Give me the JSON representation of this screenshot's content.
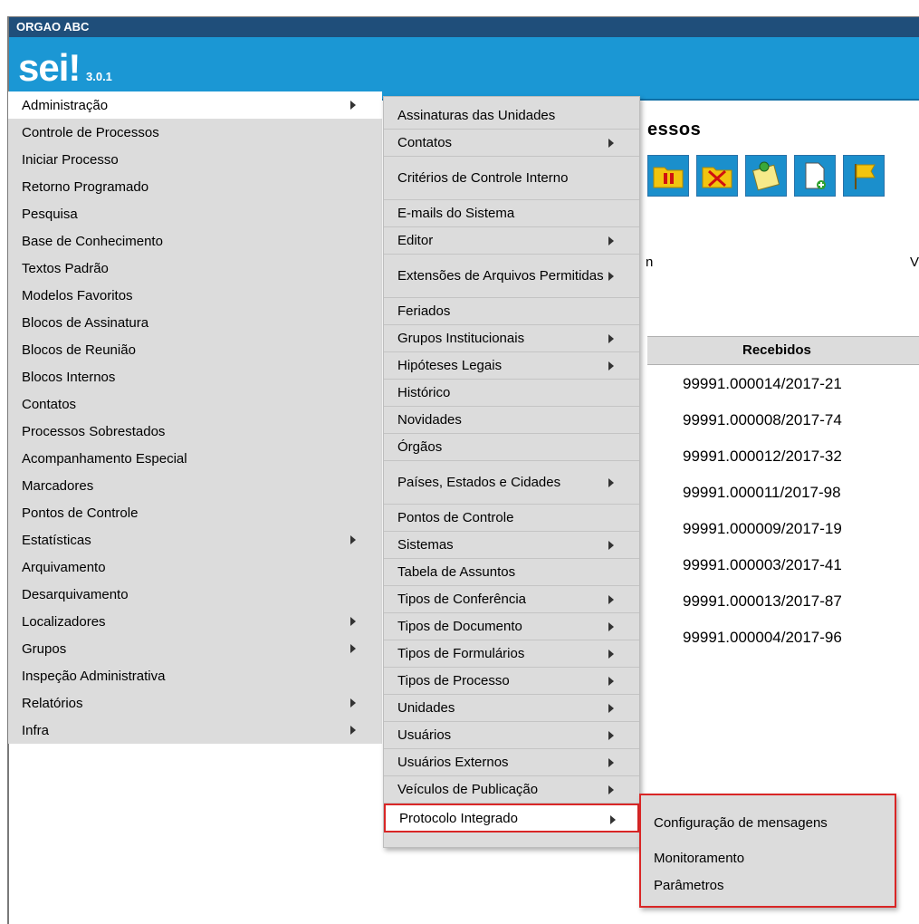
{
  "header": {
    "org_name": "ORGAO ABC",
    "logo_text": "sei",
    "logo_excl": "!",
    "version": "3.0.1"
  },
  "background": {
    "title_fragment": "essos",
    "text_fragment_1": "n",
    "text_fragment_2": "V",
    "table_header": "Recebidos",
    "processes": [
      "99991.000014/2017-21",
      "99991.000008/2017-74",
      "99991.000012/2017-32",
      "99991.000011/2017-98",
      "99991.000009/2017-19",
      "99991.000003/2017-41",
      "99991.000013/2017-87",
      "99991.000004/2017-96"
    ],
    "toolbar_icons": [
      "folder-pause-icon",
      "remove-folder-icon",
      "attach-note-icon",
      "new-document-icon",
      "flag-icon"
    ]
  },
  "main_menu": [
    {
      "label": "Administração",
      "submenu": true,
      "active": true
    },
    {
      "label": "Controle de Processos",
      "submenu": false
    },
    {
      "label": "Iniciar Processo",
      "submenu": false
    },
    {
      "label": "Retorno Programado",
      "submenu": false
    },
    {
      "label": "Pesquisa",
      "submenu": false
    },
    {
      "label": "Base de Conhecimento",
      "submenu": false
    },
    {
      "label": "Textos Padrão",
      "submenu": false
    },
    {
      "label": "Modelos Favoritos",
      "submenu": false
    },
    {
      "label": "Blocos de Assinatura",
      "submenu": false
    },
    {
      "label": "Blocos de Reunião",
      "submenu": false
    },
    {
      "label": "Blocos Internos",
      "submenu": false
    },
    {
      "label": "Contatos",
      "submenu": false
    },
    {
      "label": "Processos Sobrestados",
      "submenu": false
    },
    {
      "label": "Acompanhamento Especial",
      "submenu": false
    },
    {
      "label": "Marcadores",
      "submenu": false
    },
    {
      "label": "Pontos de Controle",
      "submenu": false
    },
    {
      "label": "Estatísticas",
      "submenu": true
    },
    {
      "label": "Arquivamento",
      "submenu": false
    },
    {
      "label": "Desarquivamento",
      "submenu": false
    },
    {
      "label": "Localizadores",
      "submenu": true
    },
    {
      "label": "Grupos",
      "submenu": true
    },
    {
      "label": "Inspeção Administrativa",
      "submenu": false
    },
    {
      "label": "Relatórios",
      "submenu": true
    },
    {
      "label": "Infra",
      "submenu": true
    }
  ],
  "admin_submenu": [
    {
      "label": "Assinaturas das Unidades",
      "submenu": false
    },
    {
      "label": "Contatos",
      "submenu": true
    },
    {
      "label": "Critérios de Controle Interno",
      "submenu": false
    },
    {
      "label": "E-mails do Sistema",
      "submenu": false
    },
    {
      "label": "Editor",
      "submenu": true
    },
    {
      "label": "Extensões de Arquivos Permitidas",
      "submenu": true
    },
    {
      "label": "Feriados",
      "submenu": false
    },
    {
      "label": "Grupos Institucionais",
      "submenu": true
    },
    {
      "label": "Hipóteses Legais",
      "submenu": true
    },
    {
      "label": "Histórico",
      "submenu": false
    },
    {
      "label": "Novidades",
      "submenu": false
    },
    {
      "label": "Órgãos",
      "submenu": false
    },
    {
      "label": "Países, Estados e Cidades",
      "submenu": true
    },
    {
      "label": "Pontos de Controle",
      "submenu": false
    },
    {
      "label": "Sistemas",
      "submenu": true
    },
    {
      "label": "Tabela de Assuntos",
      "submenu": false
    },
    {
      "label": "Tipos de Conferência",
      "submenu": true
    },
    {
      "label": "Tipos de Documento",
      "submenu": true
    },
    {
      "label": "Tipos de Formulários",
      "submenu": true
    },
    {
      "label": "Tipos de Processo",
      "submenu": true
    },
    {
      "label": "Unidades",
      "submenu": true
    },
    {
      "label": "Usuários",
      "submenu": true
    },
    {
      "label": "Usuários Externos",
      "submenu": true
    },
    {
      "label": "Veículos de Publicação",
      "submenu": true
    },
    {
      "label": "Protocolo Integrado",
      "submenu": true,
      "highlight": true
    }
  ],
  "protocolo_submenu": [
    {
      "label": "Configuração de mensagens"
    },
    {
      "label": "Monitoramento"
    },
    {
      "label": "Parâmetros"
    }
  ],
  "colors": {
    "org_bar": "#1f4e7a",
    "banner": "#1b97d4",
    "menu_bg": "#dcdcdc",
    "highlight_border": "#d92626"
  }
}
